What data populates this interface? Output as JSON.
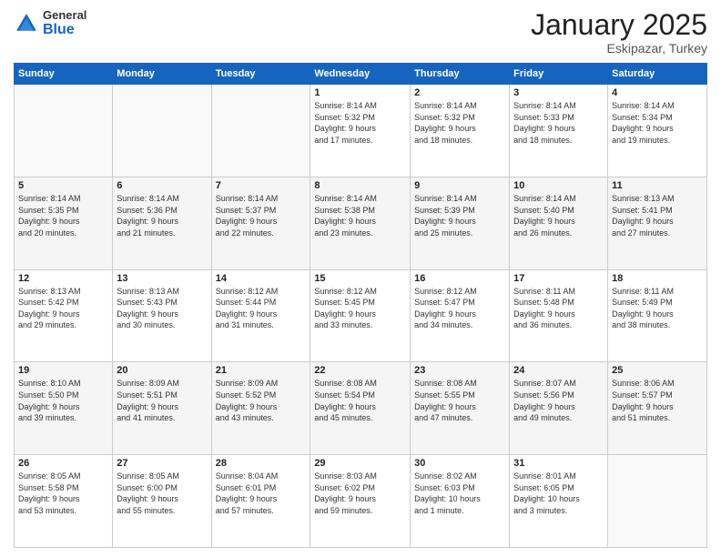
{
  "logo": {
    "general": "General",
    "blue": "Blue"
  },
  "header": {
    "month": "January 2025",
    "location": "Eskipazar, Turkey"
  },
  "weekdays": [
    "Sunday",
    "Monday",
    "Tuesday",
    "Wednesday",
    "Thursday",
    "Friday",
    "Saturday"
  ],
  "weeks": [
    [
      {
        "day": "",
        "info": ""
      },
      {
        "day": "",
        "info": ""
      },
      {
        "day": "",
        "info": ""
      },
      {
        "day": "1",
        "info": "Sunrise: 8:14 AM\nSunset: 5:32 PM\nDaylight: 9 hours\nand 17 minutes."
      },
      {
        "day": "2",
        "info": "Sunrise: 8:14 AM\nSunset: 5:32 PM\nDaylight: 9 hours\nand 18 minutes."
      },
      {
        "day": "3",
        "info": "Sunrise: 8:14 AM\nSunset: 5:33 PM\nDaylight: 9 hours\nand 18 minutes."
      },
      {
        "day": "4",
        "info": "Sunrise: 8:14 AM\nSunset: 5:34 PM\nDaylight: 9 hours\nand 19 minutes."
      }
    ],
    [
      {
        "day": "5",
        "info": "Sunrise: 8:14 AM\nSunset: 5:35 PM\nDaylight: 9 hours\nand 20 minutes."
      },
      {
        "day": "6",
        "info": "Sunrise: 8:14 AM\nSunset: 5:36 PM\nDaylight: 9 hours\nand 21 minutes."
      },
      {
        "day": "7",
        "info": "Sunrise: 8:14 AM\nSunset: 5:37 PM\nDaylight: 9 hours\nand 22 minutes."
      },
      {
        "day": "8",
        "info": "Sunrise: 8:14 AM\nSunset: 5:38 PM\nDaylight: 9 hours\nand 23 minutes."
      },
      {
        "day": "9",
        "info": "Sunrise: 8:14 AM\nSunset: 5:39 PM\nDaylight: 9 hours\nand 25 minutes."
      },
      {
        "day": "10",
        "info": "Sunrise: 8:14 AM\nSunset: 5:40 PM\nDaylight: 9 hours\nand 26 minutes."
      },
      {
        "day": "11",
        "info": "Sunrise: 8:13 AM\nSunset: 5:41 PM\nDaylight: 9 hours\nand 27 minutes."
      }
    ],
    [
      {
        "day": "12",
        "info": "Sunrise: 8:13 AM\nSunset: 5:42 PM\nDaylight: 9 hours\nand 29 minutes."
      },
      {
        "day": "13",
        "info": "Sunrise: 8:13 AM\nSunset: 5:43 PM\nDaylight: 9 hours\nand 30 minutes."
      },
      {
        "day": "14",
        "info": "Sunrise: 8:12 AM\nSunset: 5:44 PM\nDaylight: 9 hours\nand 31 minutes."
      },
      {
        "day": "15",
        "info": "Sunrise: 8:12 AM\nSunset: 5:45 PM\nDaylight: 9 hours\nand 33 minutes."
      },
      {
        "day": "16",
        "info": "Sunrise: 8:12 AM\nSunset: 5:47 PM\nDaylight: 9 hours\nand 34 minutes."
      },
      {
        "day": "17",
        "info": "Sunrise: 8:11 AM\nSunset: 5:48 PM\nDaylight: 9 hours\nand 36 minutes."
      },
      {
        "day": "18",
        "info": "Sunrise: 8:11 AM\nSunset: 5:49 PM\nDaylight: 9 hours\nand 38 minutes."
      }
    ],
    [
      {
        "day": "19",
        "info": "Sunrise: 8:10 AM\nSunset: 5:50 PM\nDaylight: 9 hours\nand 39 minutes."
      },
      {
        "day": "20",
        "info": "Sunrise: 8:09 AM\nSunset: 5:51 PM\nDaylight: 9 hours\nand 41 minutes."
      },
      {
        "day": "21",
        "info": "Sunrise: 8:09 AM\nSunset: 5:52 PM\nDaylight: 9 hours\nand 43 minutes."
      },
      {
        "day": "22",
        "info": "Sunrise: 8:08 AM\nSunset: 5:54 PM\nDaylight: 9 hours\nand 45 minutes."
      },
      {
        "day": "23",
        "info": "Sunrise: 8:08 AM\nSunset: 5:55 PM\nDaylight: 9 hours\nand 47 minutes."
      },
      {
        "day": "24",
        "info": "Sunrise: 8:07 AM\nSunset: 5:56 PM\nDaylight: 9 hours\nand 49 minutes."
      },
      {
        "day": "25",
        "info": "Sunrise: 8:06 AM\nSunset: 5:57 PM\nDaylight: 9 hours\nand 51 minutes."
      }
    ],
    [
      {
        "day": "26",
        "info": "Sunrise: 8:05 AM\nSunset: 5:58 PM\nDaylight: 9 hours\nand 53 minutes."
      },
      {
        "day": "27",
        "info": "Sunrise: 8:05 AM\nSunset: 6:00 PM\nDaylight: 9 hours\nand 55 minutes."
      },
      {
        "day": "28",
        "info": "Sunrise: 8:04 AM\nSunset: 6:01 PM\nDaylight: 9 hours\nand 57 minutes."
      },
      {
        "day": "29",
        "info": "Sunrise: 8:03 AM\nSunset: 6:02 PM\nDaylight: 9 hours\nand 59 minutes."
      },
      {
        "day": "30",
        "info": "Sunrise: 8:02 AM\nSunset: 6:03 PM\nDaylight: 10 hours\nand 1 minute."
      },
      {
        "day": "31",
        "info": "Sunrise: 8:01 AM\nSunset: 6:05 PM\nDaylight: 10 hours\nand 3 minutes."
      },
      {
        "day": "",
        "info": ""
      }
    ]
  ]
}
